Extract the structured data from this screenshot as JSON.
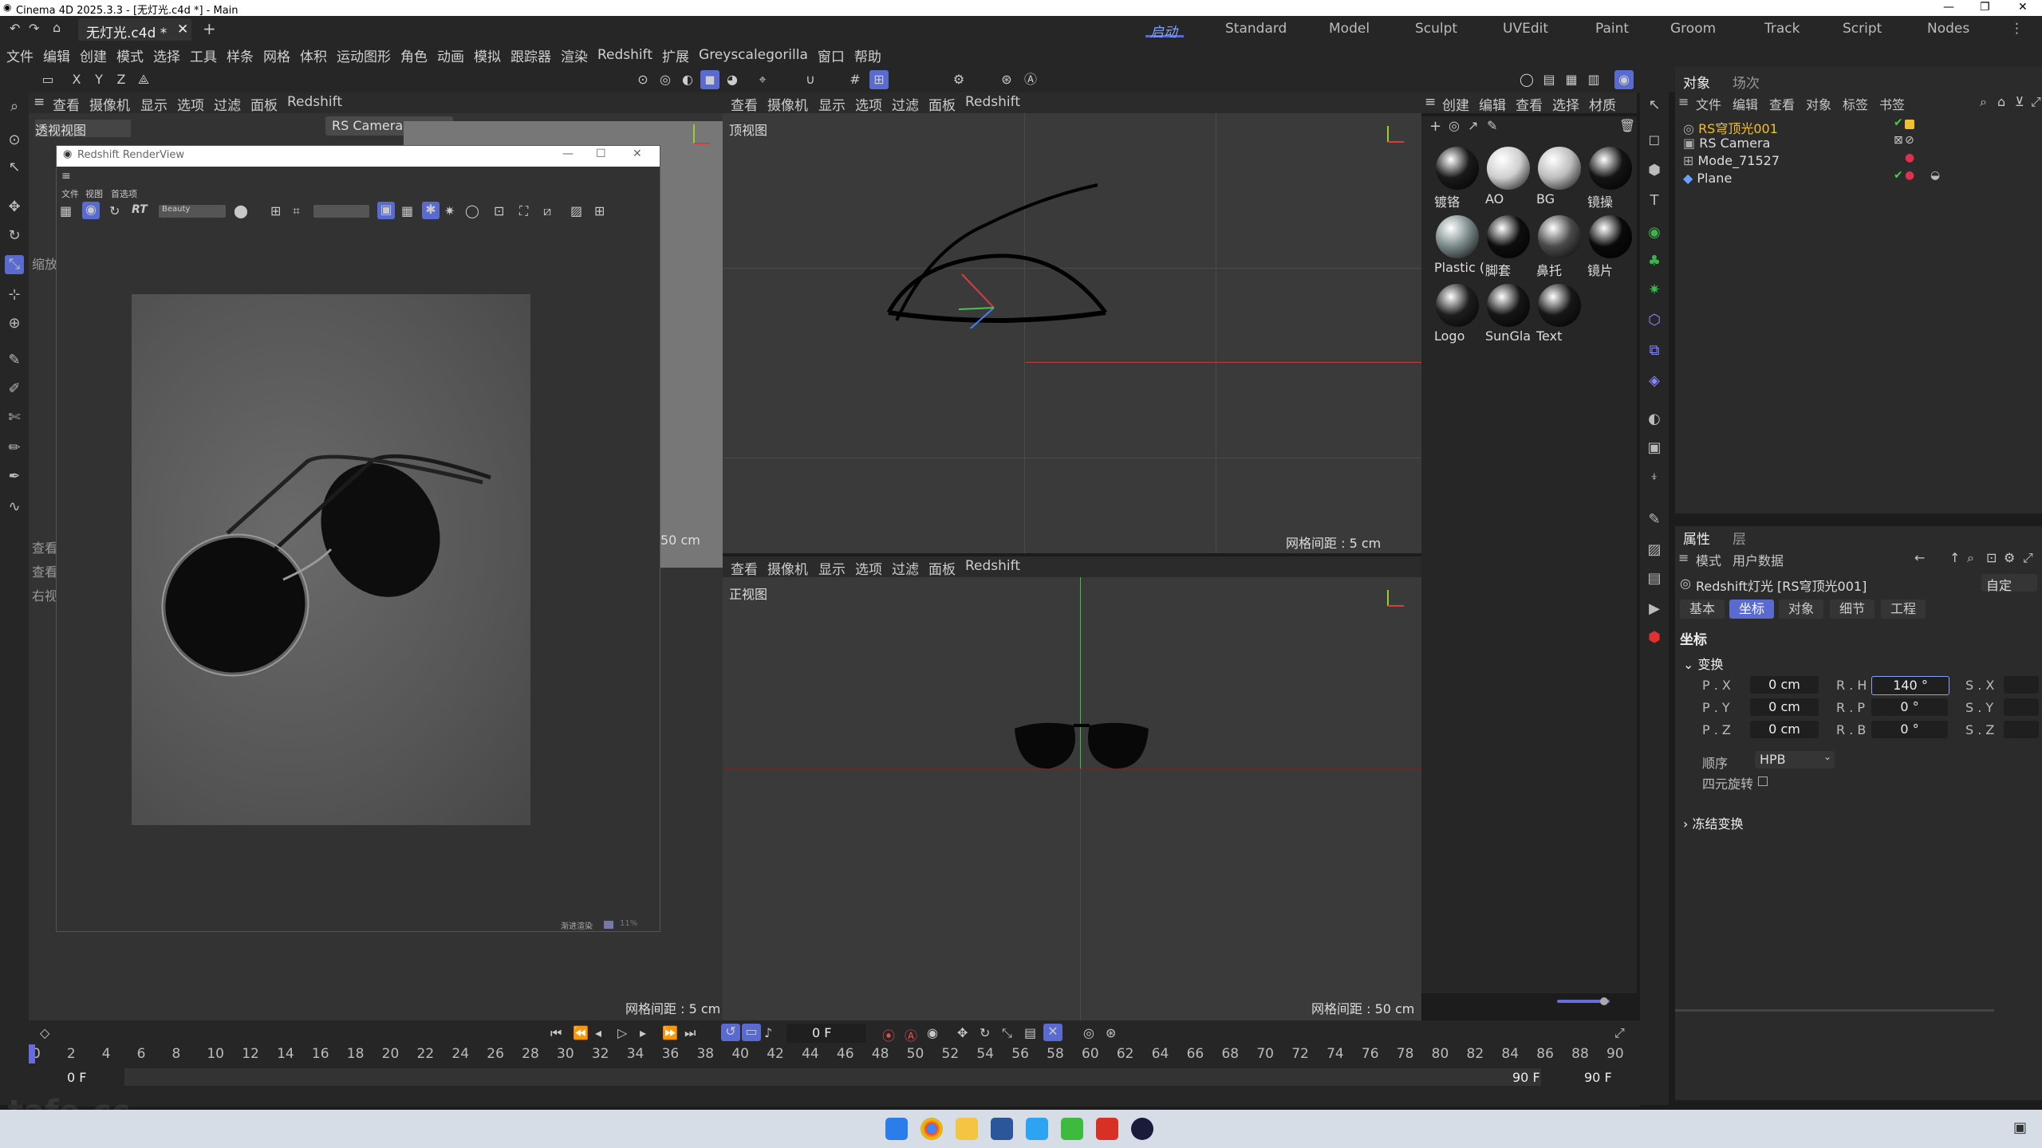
{
  "titlebar": {
    "title": "Cinema 4D 2025.3.3 - [无灯光.c4d *] - Main"
  },
  "doc_tab": {
    "label": "无灯光.c4d *"
  },
  "layouts": [
    "启动",
    "Standard",
    "Model",
    "Sculpt",
    "UVEdit",
    "Paint",
    "Groom",
    "Track",
    "Script",
    "Nodes"
  ],
  "menu": [
    "文件",
    "编辑",
    "创建",
    "模式",
    "选择",
    "工具",
    "样条",
    "网格",
    "体积",
    "运动图形",
    "角色",
    "动画",
    "模拟",
    "跟踪器",
    "渲染",
    "Redshift",
    "扩展",
    "Greyscalegorilla",
    "窗口",
    "帮助"
  ],
  "axis_buttons": [
    "X",
    "Y",
    "Z"
  ],
  "vp_menu_left": [
    "查看",
    "摄像机",
    "显示",
    "选项",
    "过滤",
    "面板",
    "Redshift"
  ],
  "vp_menu_right": [
    "查看",
    "摄像机",
    "显示",
    "选项",
    "过滤",
    "面板",
    "Redshift"
  ],
  "vp_menu_bottom": [
    "查看",
    "摄像机",
    "显示",
    "选项",
    "过滤",
    "面板",
    "Redshift"
  ],
  "viewports": {
    "persp_label": "透视视图",
    "persp_camera": "RS Camera",
    "persp_grid": "50 cm",
    "persp_side": [
      "缩放",
      "查看",
      "查看",
      "右视"
    ],
    "top_label": "顶视图",
    "top_grid": "网格间距 : 5 cm",
    "front_label": "正视图",
    "front_grid": "网格间距 : 50 cm",
    "left_bottom_grid": "网格间距 : 5 cm"
  },
  "renderview": {
    "title": "Redshift RenderView",
    "menu": [
      "文件",
      "视图",
      "首选项"
    ],
    "aov": "Beauty",
    "footer": "渐进渲染",
    "progress": "11%",
    "progress_fraction": 0.11
  },
  "material_panel": {
    "menu": [
      "创建",
      "编辑",
      "查看",
      "选择",
      "材质"
    ],
    "materials": [
      {
        "name": "镀铬",
        "color": "#1a1a1a"
      },
      {
        "name": "AO",
        "color": "#cfcfcf"
      },
      {
        "name": "BG",
        "color": "#bdbdbd"
      },
      {
        "name": "镜操",
        "color": "#141414"
      },
      {
        "name": "Plastic (",
        "color": "#7c8a8a"
      },
      {
        "name": "脚套",
        "color": "#0e0e0e"
      },
      {
        "name": "鼻托",
        "color": "#4a4a4a"
      },
      {
        "name": "镜片",
        "color": "#0a0a0a"
      },
      {
        "name": "Logo",
        "color": "#1e1e1e"
      },
      {
        "name": "SunGla",
        "color": "#161616"
      },
      {
        "name": "Text",
        "color": "#181818"
      }
    ]
  },
  "object_manager": {
    "tabs": [
      "对象",
      "场次"
    ],
    "menu": [
      "文件",
      "编辑",
      "查看",
      "对象",
      "标签",
      "书签"
    ],
    "objects": [
      "RS穹顶光001",
      "RS Camera",
      "Mode_71527",
      "Plane"
    ]
  },
  "attributes": {
    "tabs": [
      "属性",
      "层"
    ],
    "menu": [
      "模式",
      "用户数据"
    ],
    "object_title": "Redshift灯光 [RS穹顶光001]",
    "custom": "自定",
    "subtabs": [
      "基本",
      "坐标",
      "对象",
      "细节",
      "工程"
    ],
    "section": "坐标",
    "group": "变换",
    "pos": [
      {
        "label": "P . X",
        "value": "0 cm"
      },
      {
        "label": "P . Y",
        "value": "0 cm"
      },
      {
        "label": "P . Z",
        "value": "0 cm"
      }
    ],
    "rot": [
      {
        "label": "R . H",
        "value": "140 °"
      },
      {
        "label": "R . P",
        "value": "0 °"
      },
      {
        "label": "R . B",
        "value": "0 °"
      }
    ],
    "scale": [
      "S . X",
      "S . Y",
      "S . Z"
    ],
    "order_label": "顺序",
    "order_value": "HPB",
    "quat_label": "四元旋转",
    "freeze": "冻结变换"
  },
  "timeline": {
    "frame": "0 F",
    "ticks": [
      "0",
      "2",
      "4",
      "6",
      "8",
      "10",
      "12",
      "14",
      "16",
      "18",
      "20",
      "22",
      "24",
      "26",
      "28",
      "30",
      "32",
      "34",
      "36",
      "38",
      "40",
      "42",
      "44",
      "46",
      "48",
      "50",
      "52",
      "54",
      "56",
      "58",
      "60",
      "62",
      "64",
      "66",
      "68",
      "70",
      "72",
      "74",
      "76",
      "78",
      "80",
      "82",
      "84",
      "86",
      "88",
      "90"
    ],
    "start": "0 F",
    "start2": "0 F",
    "end": "90 F",
    "end2": "90 F"
  },
  "watermark": "tafe.cc",
  "colors": {
    "accent": "#5a6bd0",
    "highlight": "#f0c030"
  }
}
